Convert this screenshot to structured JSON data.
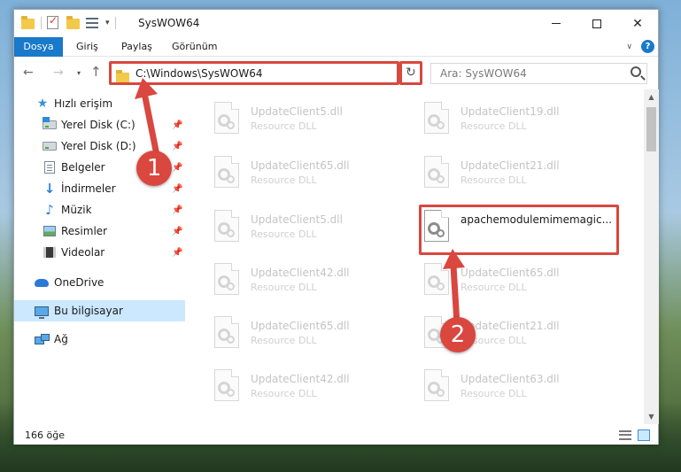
{
  "window": {
    "title": "SysWOW64",
    "controls": {
      "minimize": "",
      "maximize": "",
      "close": "✕"
    }
  },
  "ribbon": {
    "tabs": [
      "Dosya",
      "Giriş",
      "Paylaş",
      "Görünüm"
    ],
    "help": "?"
  },
  "nav": {
    "back": "←",
    "forward": "→",
    "recent": "▾",
    "up": "↑",
    "address": "C:\\Windows\\SysWOW64",
    "refresh": "↻",
    "search_placeholder": "Ara: SysWOW64"
  },
  "sidebar": {
    "items": [
      {
        "label": "Hızlı erişim",
        "icon": "star-icon",
        "pinned": false
      },
      {
        "label": "Yerel Disk (C:)",
        "icon": "drive-icon",
        "pinned": true
      },
      {
        "label": "Yerel Disk (D:)",
        "icon": "drive-icon",
        "pinned": true
      },
      {
        "label": "Belgeler",
        "icon": "documents-icon",
        "pinned": true
      },
      {
        "label": "İndirmeler",
        "icon": "download-icon",
        "pinned": true
      },
      {
        "label": "Müzik",
        "icon": "music-icon",
        "pinned": true
      },
      {
        "label": "Resimler",
        "icon": "pictures-icon",
        "pinned": true
      },
      {
        "label": "Videolar",
        "icon": "videos-icon",
        "pinned": true
      },
      {
        "label": "OneDrive",
        "icon": "onedrive-icon",
        "pinned": false
      },
      {
        "label": "Bu bilgisayar",
        "icon": "computer-icon",
        "pinned": false,
        "selected": true
      },
      {
        "label": "Ağ",
        "icon": "network-icon",
        "pinned": false
      }
    ]
  },
  "files": [
    {
      "name": "UpdateClient5.dll",
      "type": "Resource DLL",
      "col": 0,
      "row": 0
    },
    {
      "name": "UpdateClient19.dll",
      "type": "Resource DLL",
      "col": 1,
      "row": 0
    },
    {
      "name": "UpdateClient65.dll",
      "type": "Resource DLL",
      "col": 0,
      "row": 1
    },
    {
      "name": "UpdateClient21.dll",
      "type": "Resource DLL",
      "col": 1,
      "row": 1
    },
    {
      "name": "UpdateClient5.dll",
      "type": "Resource DLL",
      "col": 0,
      "row": 2
    },
    {
      "name": "apachemodulemimemagic...",
      "type": "",
      "col": 1,
      "row": 2,
      "active": true
    },
    {
      "name": "UpdateClient42.dll",
      "type": "Resource DLL",
      "col": 0,
      "row": 3
    },
    {
      "name": "UpdateClient65.dll",
      "type": "Resource DLL",
      "col": 1,
      "row": 3
    },
    {
      "name": "UpdateClient65.dll",
      "type": "Resource DLL",
      "col": 0,
      "row": 4
    },
    {
      "name": "UpdateClient21.dll",
      "type": "Resource DLL",
      "col": 1,
      "row": 4
    },
    {
      "name": "UpdateClient42.dll",
      "type": "Resource DLL",
      "col": 0,
      "row": 5
    },
    {
      "name": "UpdateClient63.dll",
      "type": "Resource DLL",
      "col": 1,
      "row": 5
    }
  ],
  "status": {
    "count": "166 öğe"
  },
  "callouts": {
    "one": "1",
    "two": "2"
  },
  "colors": {
    "accent": "#1979ca",
    "highlight": "#d9473f",
    "selection": "#cce8ff"
  }
}
